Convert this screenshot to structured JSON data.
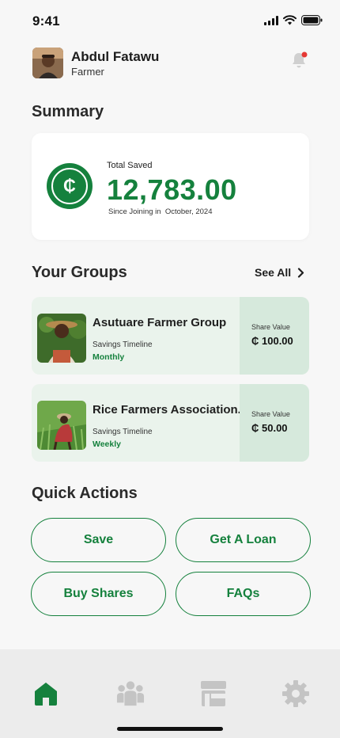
{
  "status_bar": {
    "time": "9:41"
  },
  "user": {
    "name": "Abdul Fatawu",
    "role": "Farmer"
  },
  "summary": {
    "title": "Summary",
    "total_label": "Total Saved",
    "currency_symbol": "₵",
    "amount": "12,783.00",
    "since_text": "Since Joining in  October, 2024"
  },
  "groups": {
    "title": "Your Groups",
    "see_all_label": "See All",
    "items": [
      {
        "name": "Asutuare Farmer Group",
        "timeline_label": "Savings Timeline",
        "timeline_value": "Monthly",
        "share_label": "Share Value",
        "share_value": "₵ 100.00"
      },
      {
        "name": "Rice Farmers Association.",
        "timeline_label": "Savings Timeline",
        "timeline_value": "Weekly",
        "share_label": "Share Value",
        "share_value": "₵ 50.00"
      }
    ]
  },
  "quick_actions": {
    "title": "Quick Actions",
    "save_label": "Save",
    "loan_label": "Get A Loan",
    "buy_shares_label": "Buy Shares",
    "faqs_label": "FAQs"
  },
  "nav": {
    "items": [
      "home-icon",
      "groups-icon",
      "marketplace-icon",
      "settings-icon"
    ],
    "active": "home-icon"
  },
  "colors": {
    "accent": "#15813d",
    "card_bg": "#eaf3ec",
    "share_bg": "#d6e9dc",
    "notification_dot": "#e53935",
    "inactive_icon": "#c4c4c4"
  }
}
